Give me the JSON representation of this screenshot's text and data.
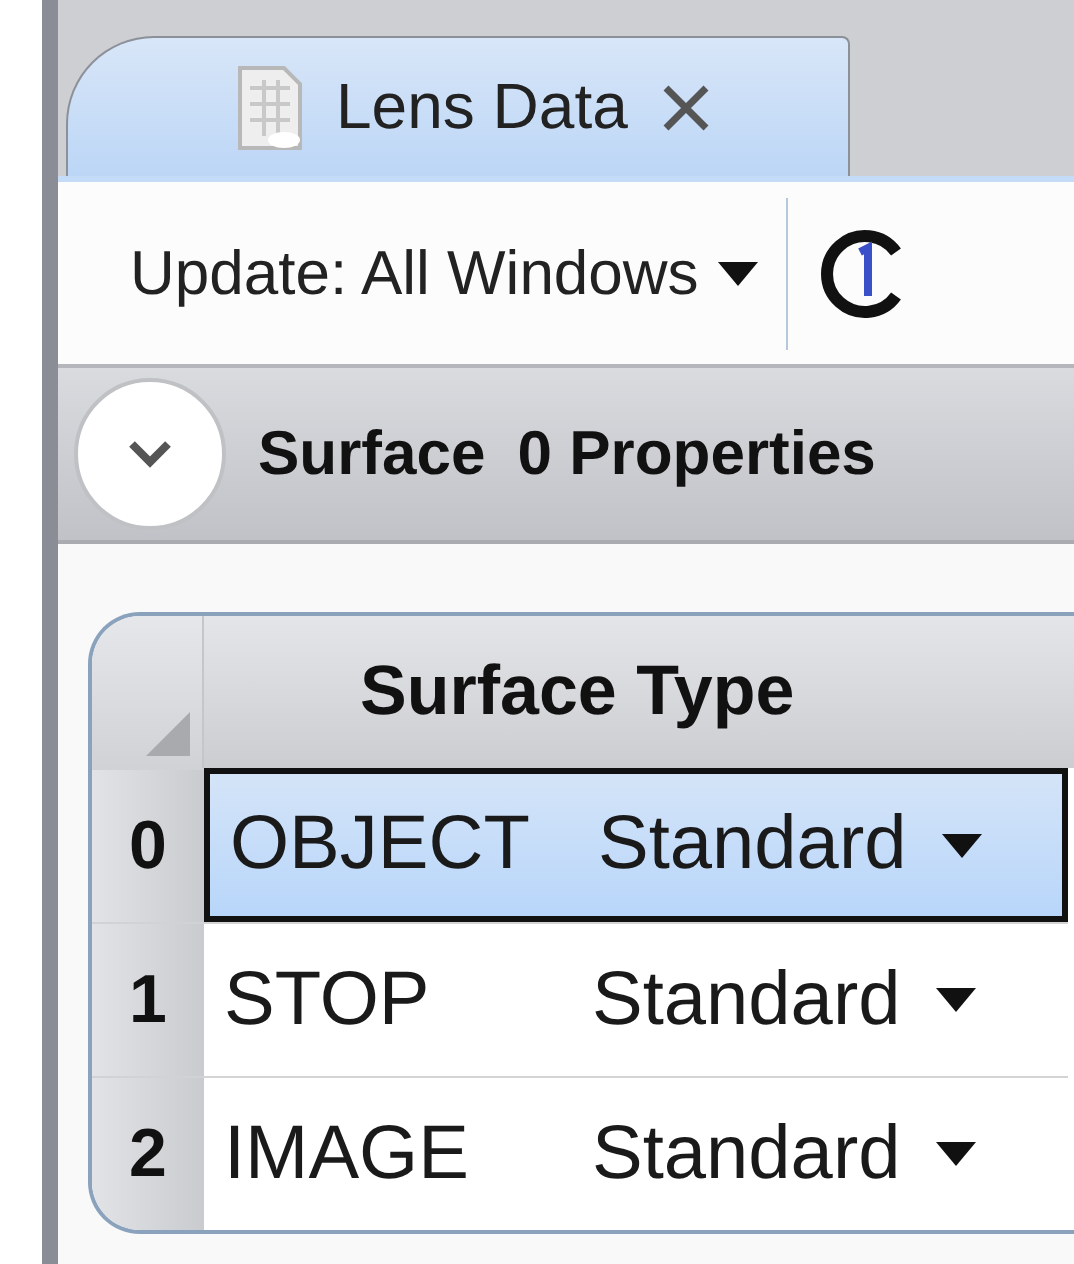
{
  "tab": {
    "title": "Lens Data",
    "selected": true
  },
  "toolbar": {
    "update_label": "Update: All Windows"
  },
  "section_bar": {
    "title": "Surface",
    "properties": "0 Properties",
    "expanded": true
  },
  "table": {
    "columns": [
      "Surface Type"
    ],
    "rows": [
      {
        "number": "0",
        "name": "OBJECT",
        "type": "Standard",
        "selected": true
      },
      {
        "number": "1",
        "name": "STOP",
        "type": "Standard",
        "selected": false
      },
      {
        "number": "2",
        "name": "IMAGE",
        "type": "Standard",
        "selected": false
      }
    ]
  }
}
